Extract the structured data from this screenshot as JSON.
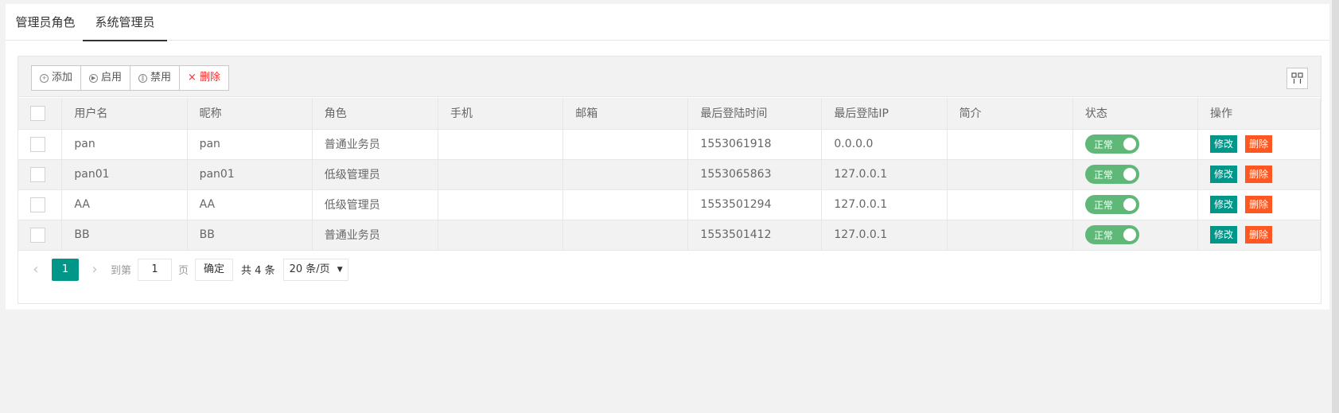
{
  "tabs": [
    {
      "label": "管理员角色",
      "active": false
    },
    {
      "label": "系统管理员",
      "active": true
    }
  ],
  "toolbar": {
    "add_label": "添加",
    "enable_label": "启用",
    "disable_label": "禁用",
    "delete_label": "删除"
  },
  "table": {
    "headers": [
      "用户名",
      "昵称",
      "角色",
      "手机",
      "邮箱",
      "最后登陆时间",
      "最后登陆IP",
      "简介",
      "状态",
      "操作"
    ],
    "rows": [
      {
        "username": "pan",
        "nickname": "pan",
        "role": "普通业务员",
        "phone": "",
        "email": "",
        "last_login_time": "1553061918",
        "last_login_ip": "0.0.0.0",
        "intro": "",
        "status": "正常"
      },
      {
        "username": "pan01",
        "nickname": "pan01",
        "role": "低级管理员",
        "phone": "",
        "email": "",
        "last_login_time": "1553065863",
        "last_login_ip": "127.0.0.1",
        "intro": "",
        "status": "正常"
      },
      {
        "username": "AA",
        "nickname": "AA",
        "role": "低级管理员",
        "phone": "",
        "email": "",
        "last_login_time": "1553501294",
        "last_login_ip": "127.0.0.1",
        "intro": "",
        "status": "正常"
      },
      {
        "username": "BB",
        "nickname": "BB",
        "role": "普通业务员",
        "phone": "",
        "email": "",
        "last_login_time": "1553501412",
        "last_login_ip": "127.0.0.1",
        "intro": "",
        "status": "正常"
      }
    ],
    "edit_label": "修改",
    "delete_label": "删除"
  },
  "pager": {
    "current_page": "1",
    "goto_prefix": "到第",
    "goto_value": "1",
    "goto_suffix": "页",
    "confirm_label": "确定",
    "total_text": "共 4 条",
    "limit_text": "20 条/页"
  },
  "colors": {
    "accent": "#009688",
    "danger": "#ff5722",
    "switch_on": "#5fb878"
  }
}
